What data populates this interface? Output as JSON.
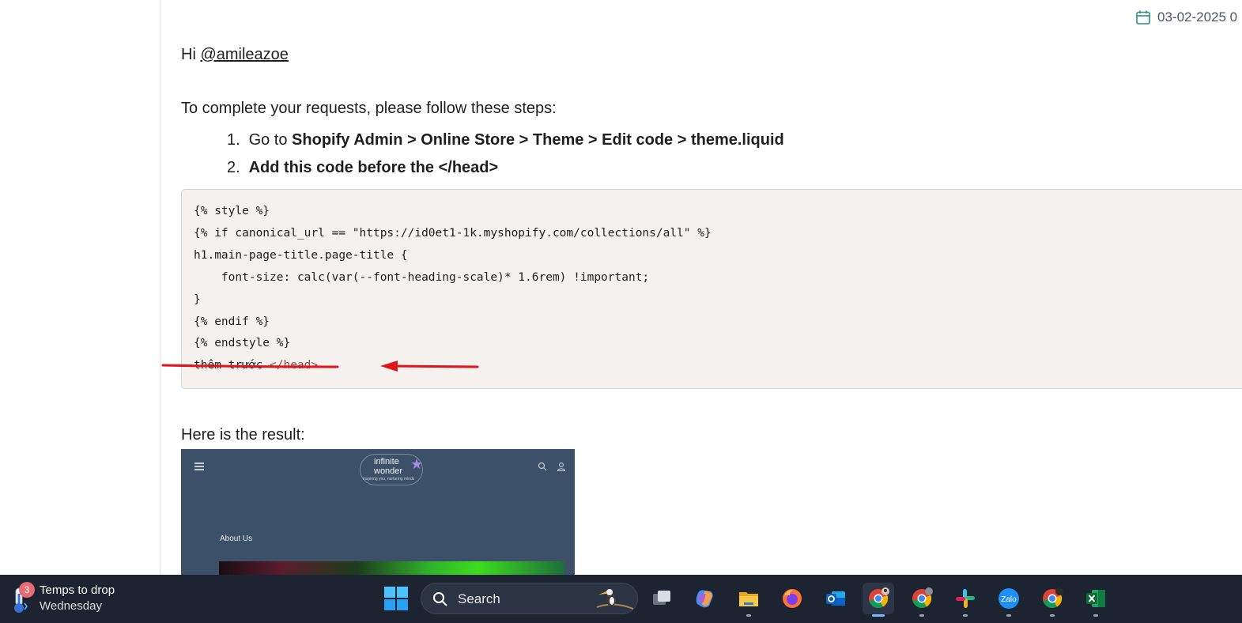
{
  "post": {
    "date": "03-02-2025 0",
    "greeting_prefix": "Hi ",
    "mention": "@amileazoe",
    "intro": "To complete your requests, please follow these steps:",
    "steps": [
      {
        "num": "1.",
        "prefix": "Go to ",
        "bold": "Shopify Admin > Online Store > Theme > Edit code > theme.liquid"
      },
      {
        "num": "2.",
        "prefix": "",
        "bold": "Add this code before the </head>"
      }
    ],
    "code_lines": [
      "{% style %}",
      "{% if canonical_url == \"https://id0et1-1k.myshopify.com/collections/all\" %}",
      "h1.main-page-title.page-title {",
      "    font-size: calc(var(--font-heading-scale)* 1.6rem) !important;",
      "}",
      "{% endif %}",
      "{% endstyle %}"
    ],
    "code_last_text": "thêm trước ",
    "code_last_tag": "</head>",
    "result_label": "Here is the result:",
    "result_image": {
      "logo_line1": "infinite",
      "logo_line2": "wonder",
      "logo_tagline": "inspiring you, nurturing minds",
      "page_heading": "About Us"
    }
  },
  "annotation": {
    "color": "#e0141b"
  },
  "taskbar": {
    "weather_badge": "3",
    "weather_title": "Temps to drop",
    "weather_subtitle": "Wednesday",
    "search_placeholder": "Search",
    "apps": [
      "task-view",
      "copilot",
      "file-explorer",
      "firefox",
      "outlook",
      "chrome-profile-1",
      "chrome-profile-2",
      "slack",
      "zalo",
      "chrome-profile-3",
      "excel"
    ]
  }
}
